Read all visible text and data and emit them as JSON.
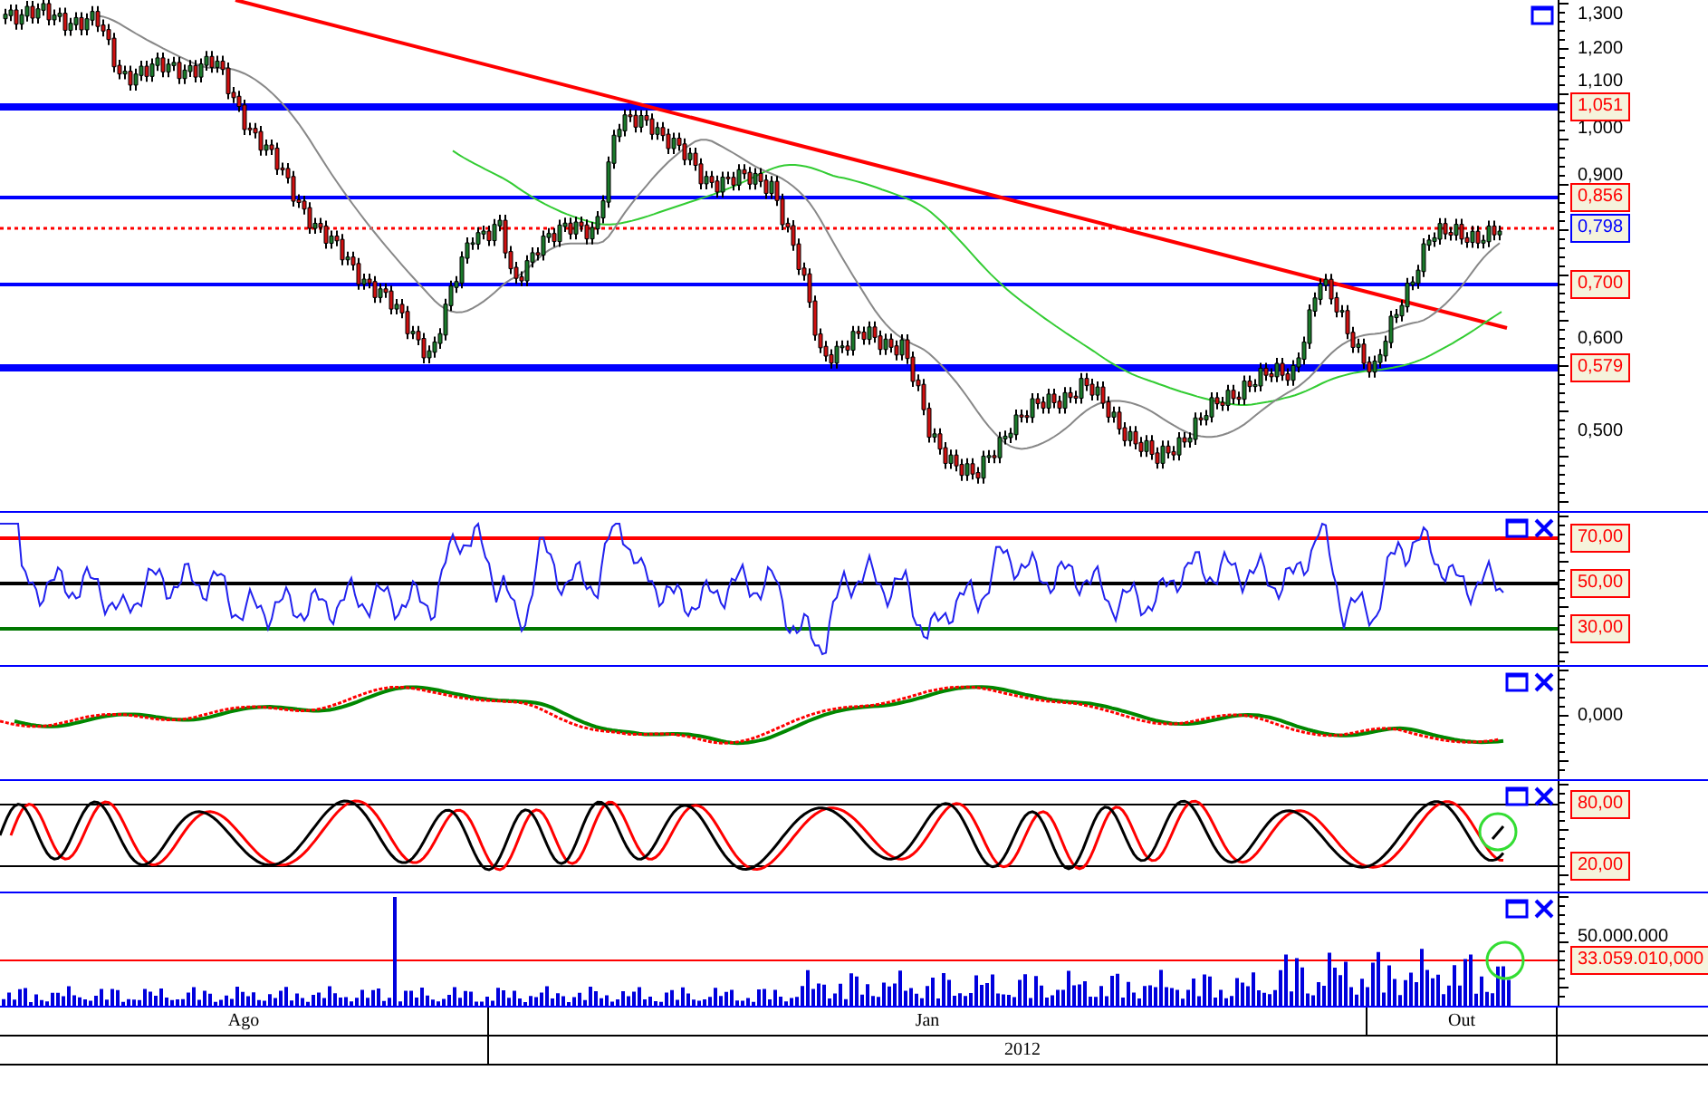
{
  "panels": [
    {
      "kind": "price",
      "closable": false,
      "ticks": [
        "1,300",
        "1,200",
        "1,100",
        "1,000",
        "0,900",
        "0,600",
        "0,500"
      ],
      "tags": [
        {
          "text": "1,051",
          "color": "#ff0000"
        },
        {
          "text": "0,856",
          "color": "#ff0000"
        },
        {
          "text": "0,798",
          "color": "#0000ff"
        },
        {
          "text": "0,700",
          "color": "#ff0000"
        },
        {
          "text": "0,579",
          "color": "#ff0000"
        }
      ]
    },
    {
      "kind": "rsi",
      "closable": true,
      "tags": [
        {
          "text": "70,00",
          "color": "#ff0000"
        },
        {
          "text": "50,00",
          "color": "#ff0000"
        },
        {
          "text": "30,00",
          "color": "#ff0000"
        }
      ]
    },
    {
      "kind": "macd",
      "closable": true,
      "ticks": [
        "0,000"
      ]
    },
    {
      "kind": "stochastic",
      "closable": true,
      "tags": [
        {
          "text": "80,00",
          "color": "#ff0000"
        },
        {
          "text": "20,00",
          "color": "#ff0000"
        }
      ]
    },
    {
      "kind": "volume",
      "closable": true,
      "ticks": [
        "50.000.000"
      ],
      "tags": [
        {
          "text": "33.059.010,000",
          "color": "#ff0000"
        }
      ]
    }
  ],
  "time_axis": {
    "months": [
      "Ago",
      "Jan",
      "Out"
    ],
    "years": [
      "2012"
    ]
  }
}
